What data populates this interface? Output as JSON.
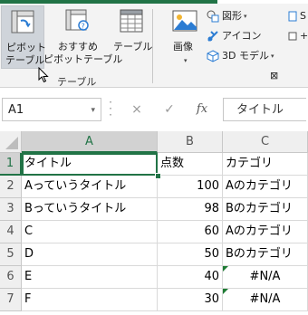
{
  "ribbon": {
    "pivot_label_1": "ピボット",
    "pivot_label_2": "テーブル",
    "recommended_label_1": "おすすめ",
    "recommended_label_2": "ピボットテーブル",
    "table_label": "テーブル",
    "group_label": "テーブル",
    "image_label": "画像",
    "shapes_label": "図形",
    "icons_label": "アイコン",
    "model3d_label": "3D モデル",
    "illus_launcher": "⊠",
    "cut_s": "S",
    "cut_plus": "+"
  },
  "formula_bar": {
    "name_box": "A1",
    "fx": "fx",
    "cancel": "×",
    "enter": "✓",
    "value": "タイトル"
  },
  "sheet": {
    "columns": [
      "A",
      "B",
      "C"
    ],
    "rows": [
      {
        "n": "1",
        "a": "タイトル",
        "b": "点数",
        "c": "カテゴリ"
      },
      {
        "n": "2",
        "a": "Aっていうタイトル",
        "b": "100",
        "c": "Aのカテゴリ"
      },
      {
        "n": "3",
        "a": "Bっていうタイトル",
        "b": "98",
        "c": "Bのカテゴリ"
      },
      {
        "n": "4",
        "a": "C",
        "b": "60",
        "c": "Aのカテゴリ"
      },
      {
        "n": "5",
        "a": "D",
        "b": "50",
        "c": "Bのカテゴリ"
      },
      {
        "n": "6",
        "a": "E",
        "b": "40",
        "c": "#N/A"
      },
      {
        "n": "7",
        "a": "F",
        "b": "30",
        "c": "#N/A"
      }
    ]
  },
  "colors": {
    "accent": "#217346",
    "header_bg": "#efefef",
    "selected_header_bg": "#d2d2d2"
  }
}
